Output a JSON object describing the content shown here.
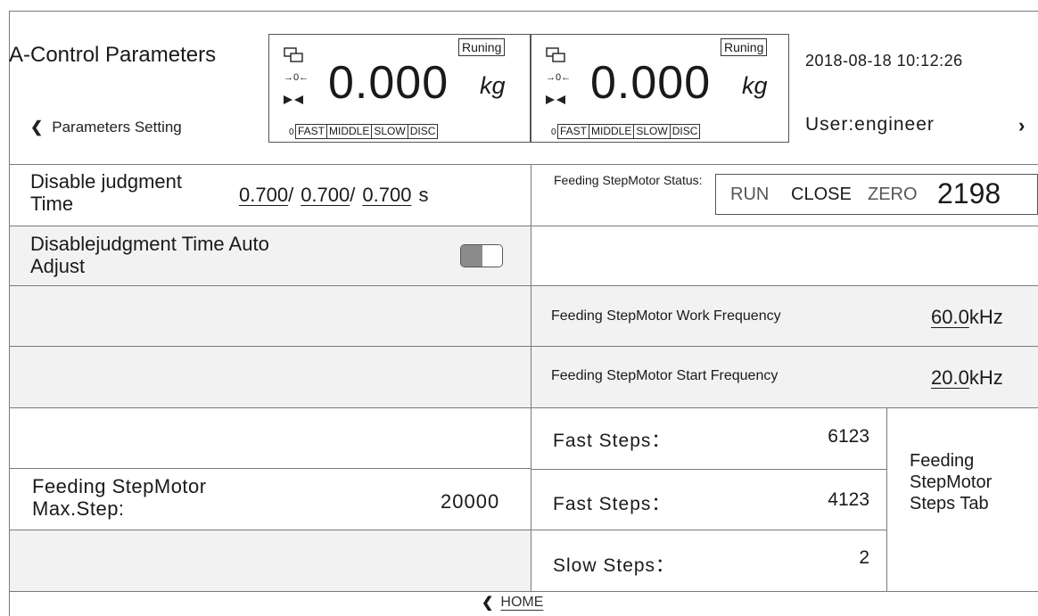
{
  "header": {
    "title": "A-Control Parameters",
    "subnav_label": "Parameters Setting",
    "datetime": "2018-08-18 10:12:26",
    "user": "User:engineer"
  },
  "displays": [
    {
      "status": "Runing",
      "value": "0.000",
      "unit": "kg",
      "zero_mark": "0",
      "modes": [
        "FAST",
        "MIDDLE",
        "SLOW",
        "DISC"
      ]
    },
    {
      "status": "Runing",
      "value": "0.000",
      "unit": "kg",
      "zero_mark": "0",
      "modes": [
        "FAST",
        "MIDDLE",
        "SLOW",
        "DISC"
      ]
    }
  ],
  "left": {
    "disable_time": {
      "label": "Disable judgment Time",
      "v1": "0.700",
      "v2": "0.700",
      "v3": "0.700",
      "sep": "/",
      "unit": "s"
    },
    "auto_adjust": {
      "label": "Disablejudgment Time Auto Adjust",
      "enabled": true
    },
    "max_step": {
      "label": "Feeding StepMotor Max.Step:",
      "value": "20000"
    }
  },
  "right": {
    "motor_status": {
      "label": "Feeding StepMotor Status:",
      "run": "RUN",
      "close": "CLOSE",
      "zero": "ZERO",
      "count": "2198"
    },
    "work_freq": {
      "label": "Feeding StepMotor Work Frequency",
      "value": "60.0",
      "unit": "kHz"
    },
    "start_freq": {
      "label": "Feeding StepMotor Start Frequency",
      "value": "20.0",
      "unit": "kHz"
    },
    "steps": [
      {
        "label": "Fast Steps：",
        "value": "6123"
      },
      {
        "label": "Fast Steps：",
        "value": "4123"
      },
      {
        "label": "Slow Steps：",
        "value": "2"
      }
    ],
    "steps_tab_label": "Feeding StepMotor Steps Tab"
  },
  "footer": {
    "home_label": "HOME"
  },
  "icons": {
    "back": "chevron-left-icon",
    "forward": "chevron-right-icon",
    "network": "monitor-icon",
    "zero": "zero-arrows-icon",
    "stable": "stable-icon"
  }
}
